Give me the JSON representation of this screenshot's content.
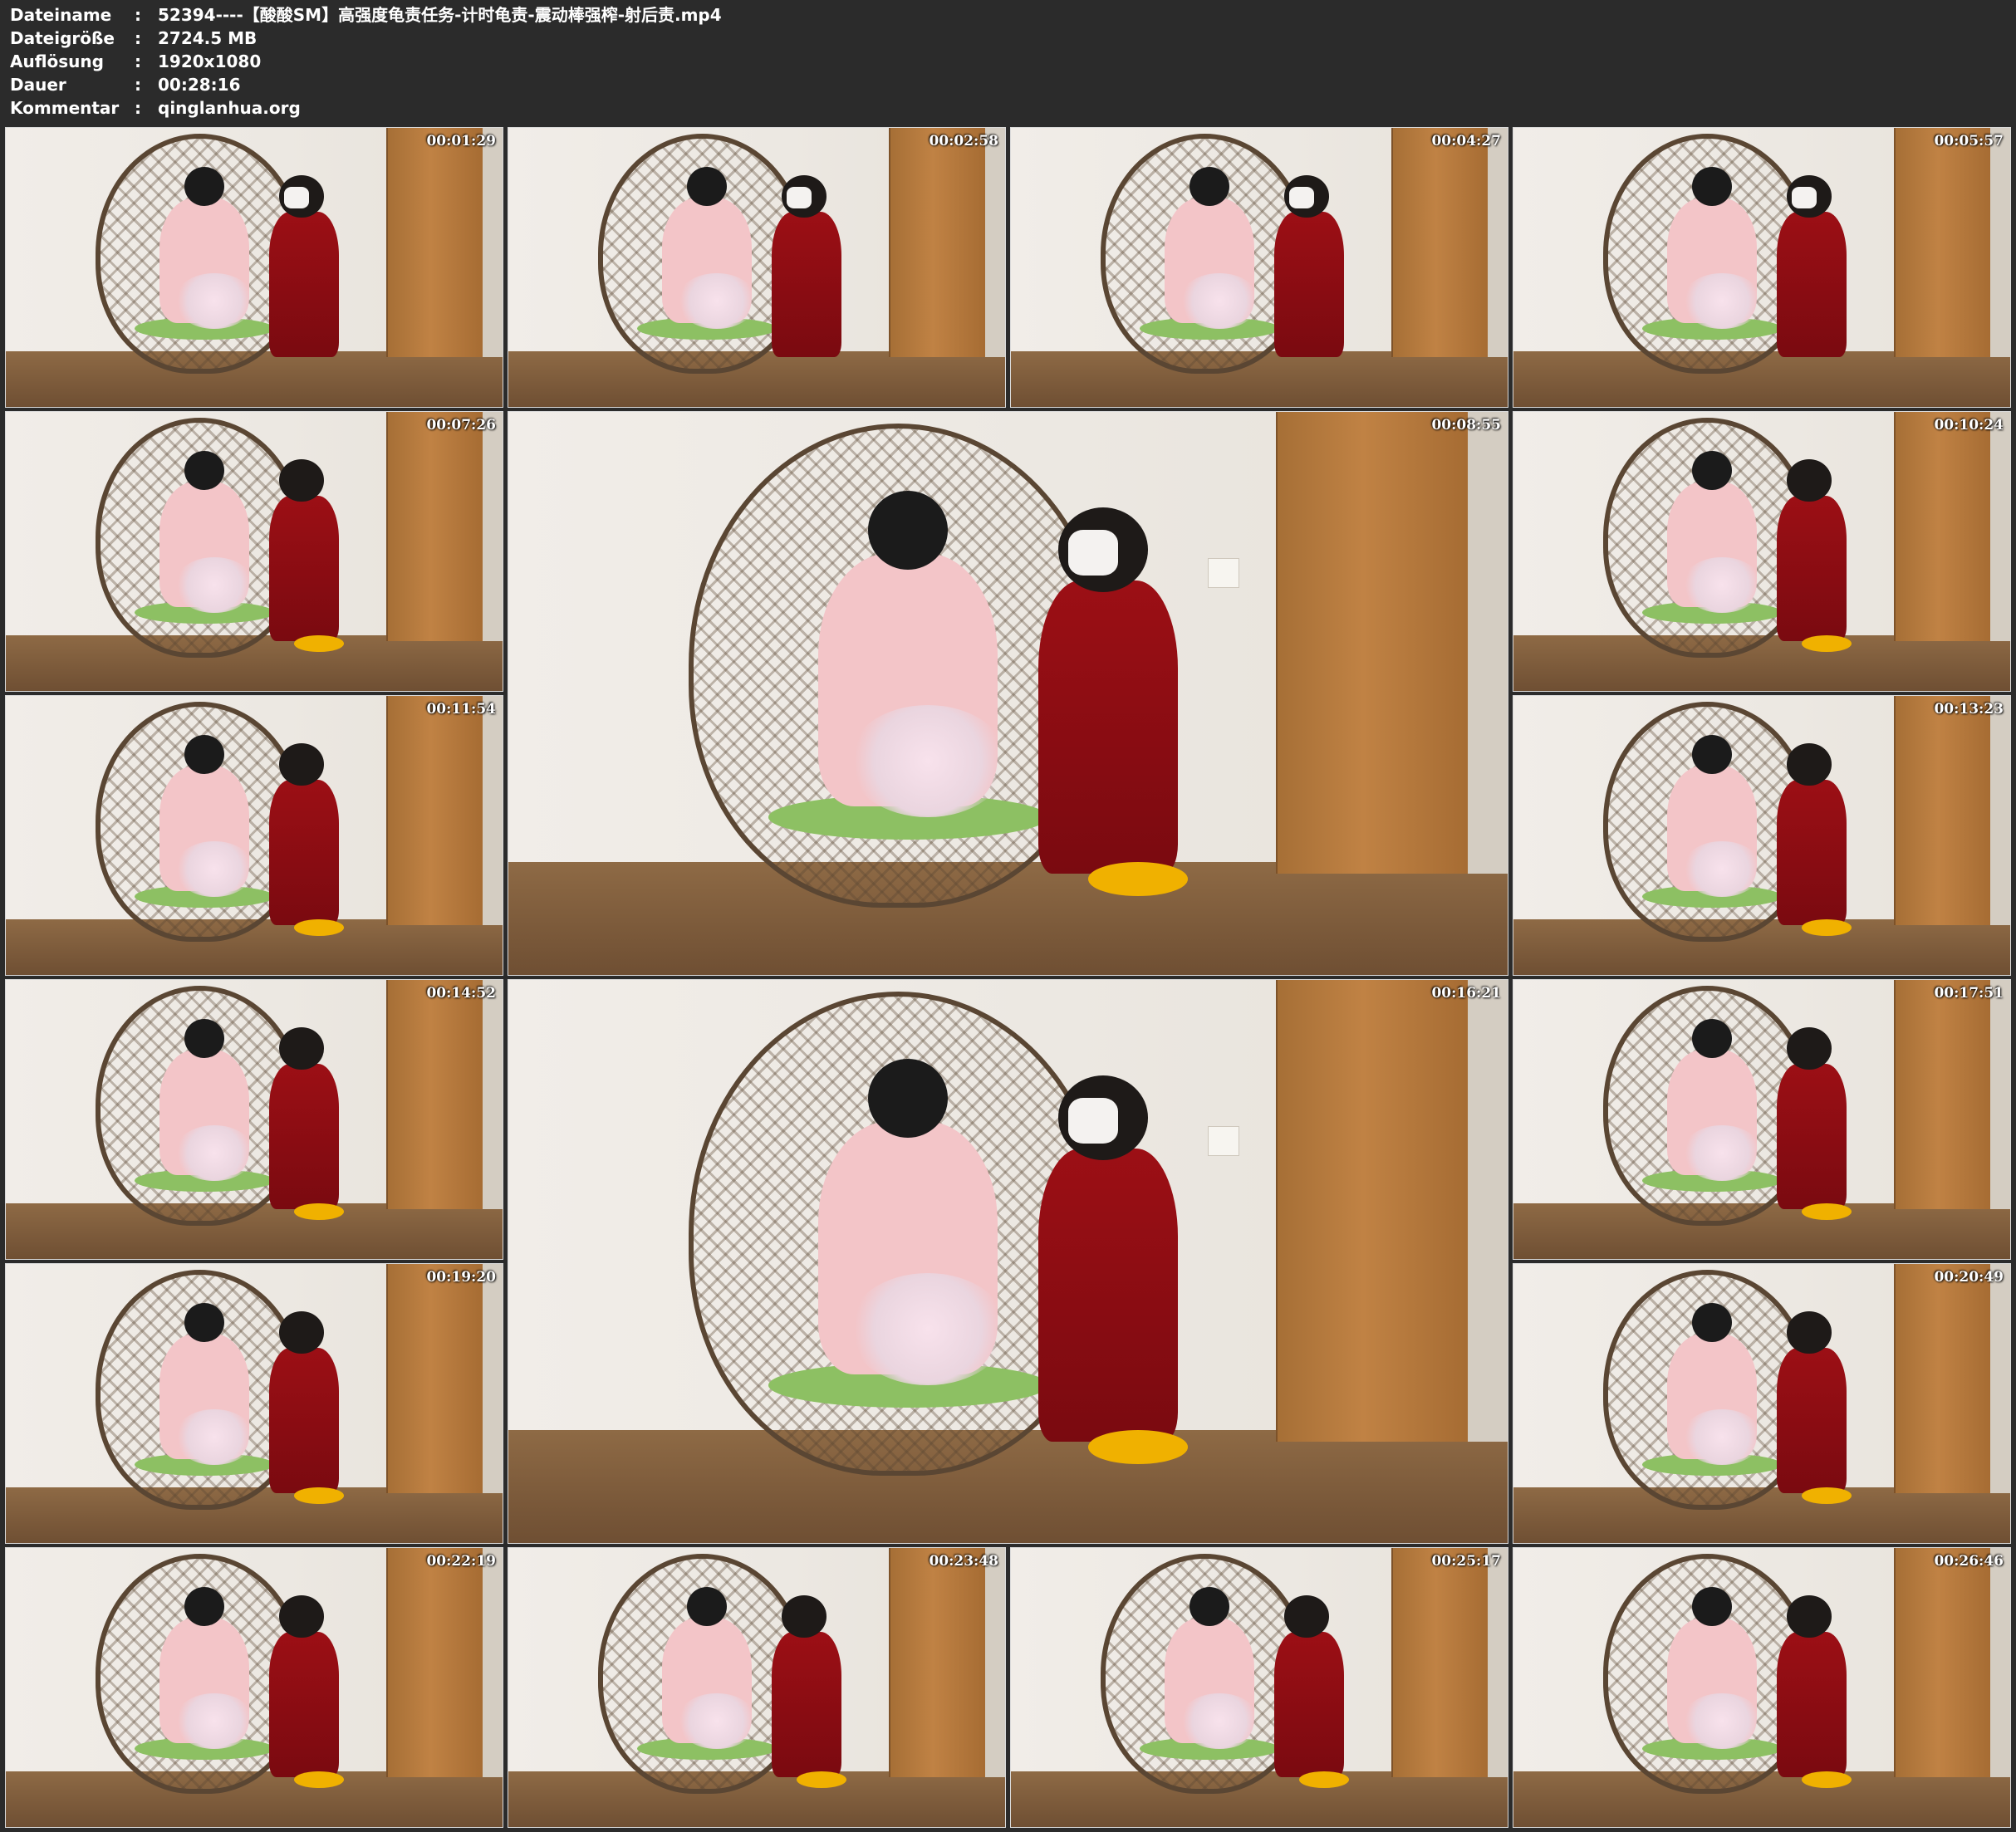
{
  "metadata": [
    {
      "label": "Dateiname",
      "sep": ":",
      "value": "52394----【酸酸SM】高强度龟责任务-计时龟责-震动棒强榨-射后责.mp4"
    },
    {
      "label": "Dateigröße",
      "sep": ":",
      "value": "2724.5 MB"
    },
    {
      "label": "Auflösung",
      "sep": ":",
      "value": "1920x1080"
    },
    {
      "label": "Dauer",
      "sep": ":",
      "value": "00:28:16"
    },
    {
      "label": "Kommentar",
      "sep": ":",
      "value": "qinglanhua.org"
    }
  ],
  "thumbnails": [
    {
      "timestamp": "00:01:29"
    },
    {
      "timestamp": "00:02:58"
    },
    {
      "timestamp": "00:04:27"
    },
    {
      "timestamp": "00:05:57"
    },
    {
      "timestamp": "00:07:26"
    },
    {
      "timestamp": "00:08:55"
    },
    {
      "timestamp": "00:10:24"
    },
    {
      "timestamp": "00:11:54"
    },
    {
      "timestamp": "00:13:23"
    },
    {
      "timestamp": "00:14:52"
    },
    {
      "timestamp": "00:16:21"
    },
    {
      "timestamp": "00:17:51"
    },
    {
      "timestamp": "00:19:20"
    },
    {
      "timestamp": "00:20:49"
    },
    {
      "timestamp": "00:22:19"
    },
    {
      "timestamp": "00:23:48"
    },
    {
      "timestamp": "00:25:17"
    },
    {
      "timestamp": "00:26:46"
    }
  ]
}
